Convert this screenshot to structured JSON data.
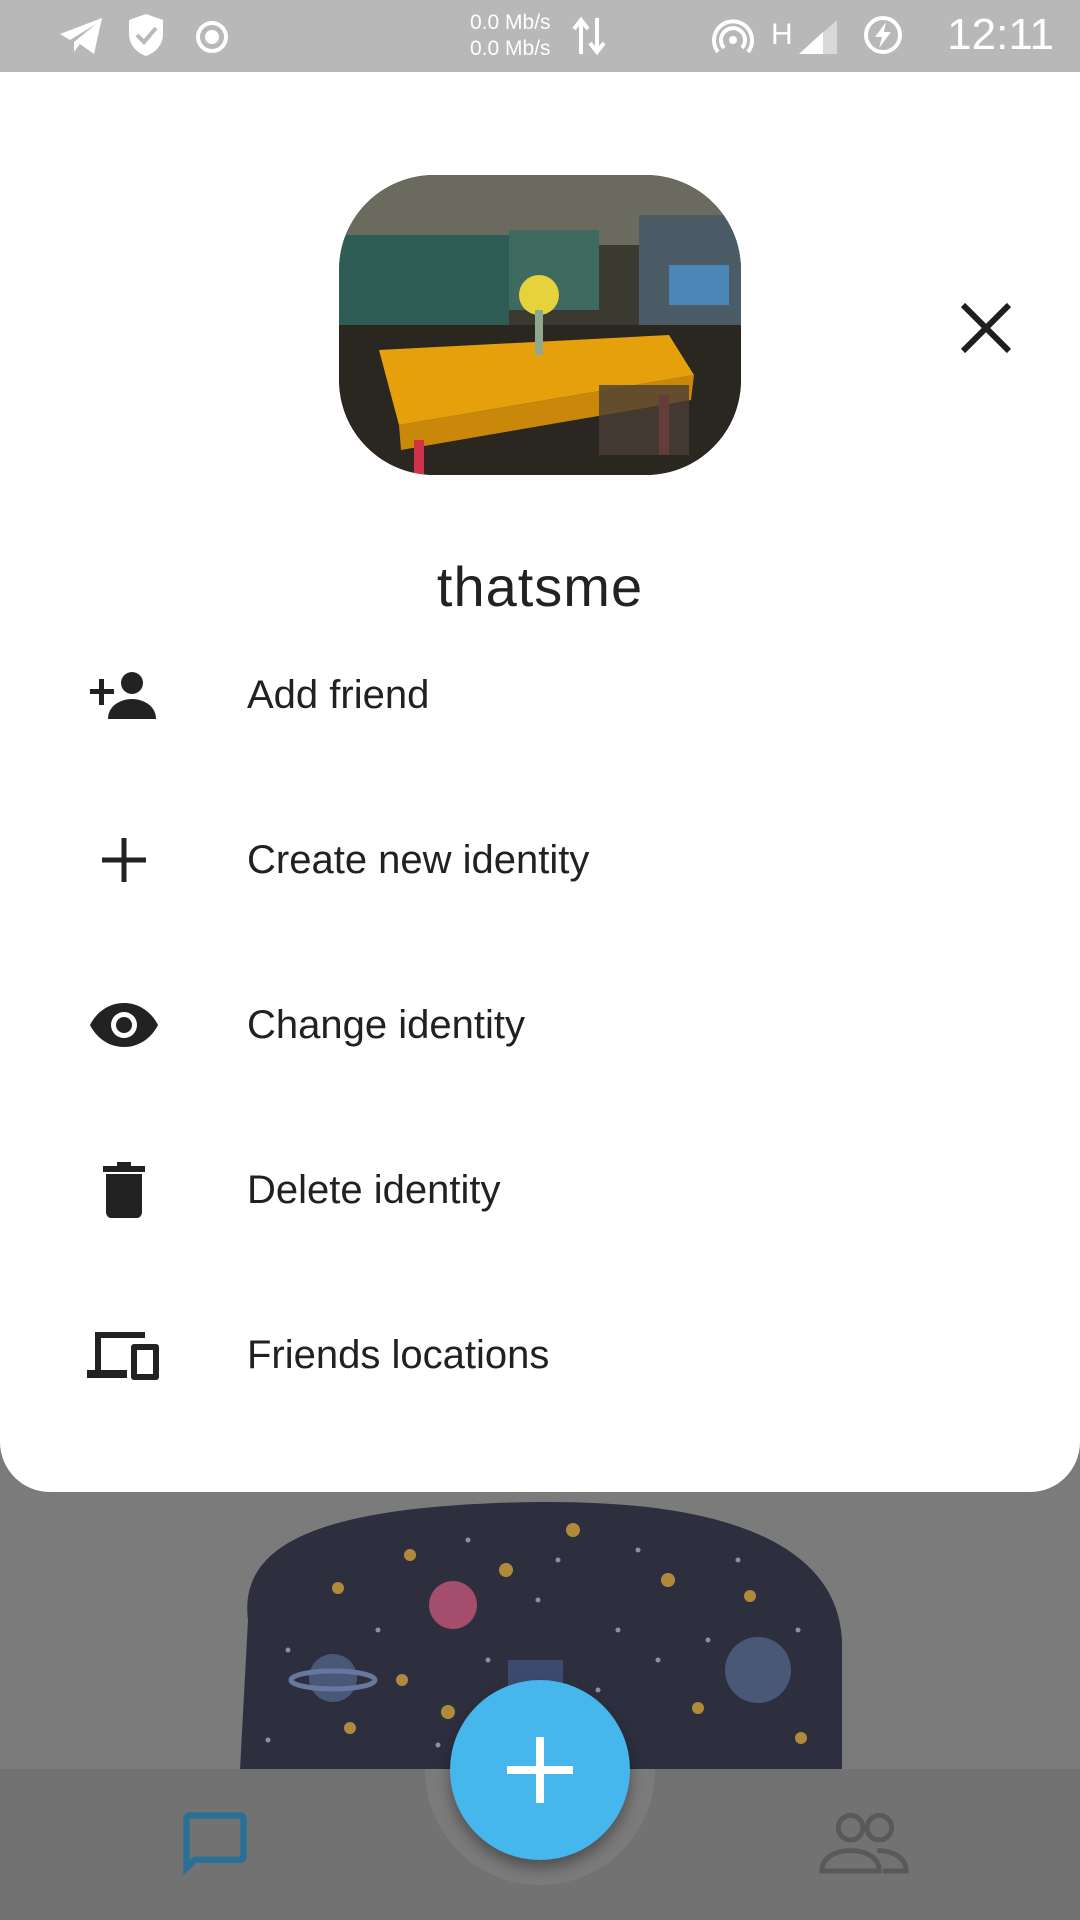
{
  "status_bar": {
    "speed_up": "0.0 Mb/s",
    "speed_down": "0.0 Mb/s",
    "network_type": "H",
    "time": "12:11"
  },
  "profile": {
    "username": "thatsme"
  },
  "menu": {
    "items": [
      {
        "label": "Add friend",
        "icon": "person-add-icon"
      },
      {
        "label": "Create new identity",
        "icon": "plus-icon"
      },
      {
        "label": "Change identity",
        "icon": "eye-icon"
      },
      {
        "label": "Delete identity",
        "icon": "trash-icon"
      },
      {
        "label": "Friends locations",
        "icon": "devices-icon"
      }
    ]
  },
  "colors": {
    "fab": "#45b7ec",
    "nav_chat_active": "#2a6f95",
    "sheet_background": "#ffffff",
    "scrim": "#7b7b7b"
  }
}
